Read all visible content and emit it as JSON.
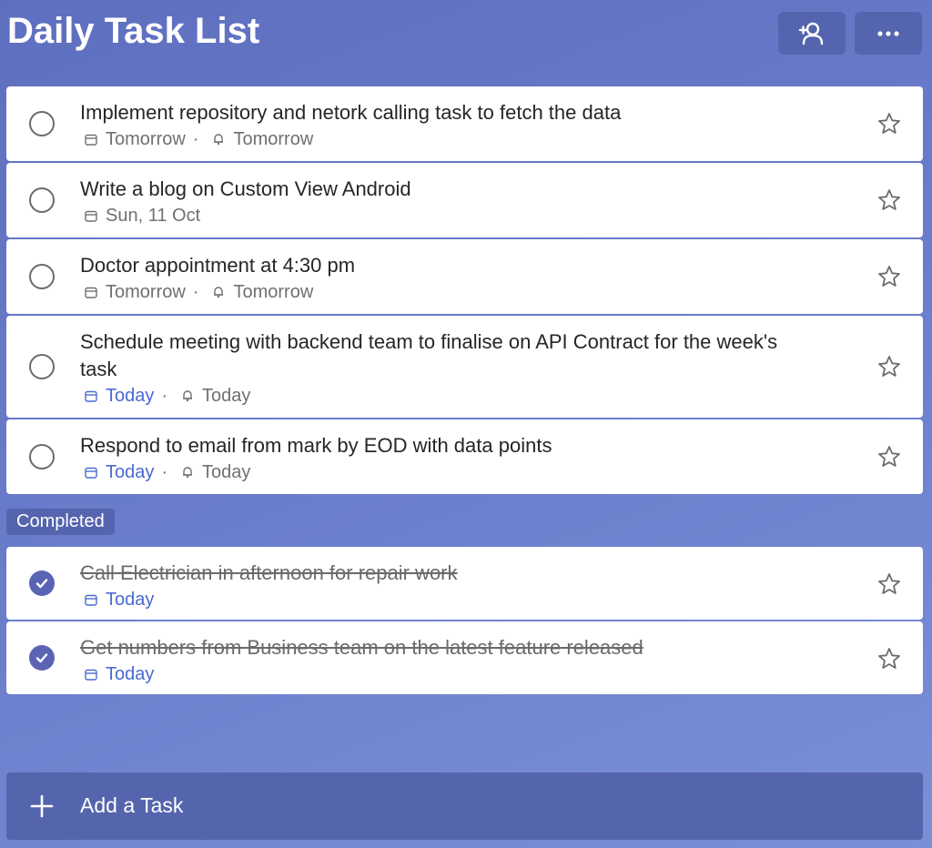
{
  "header": {
    "title": "Daily Task List",
    "share_icon": "person-add-icon",
    "more_icon": "more-horizontal-icon"
  },
  "tasks": [
    {
      "title": "Implement repository and netork calling task to fetch the data",
      "due": "Tomorrow",
      "reminder": "Tomorrow",
      "due_color": "gray"
    },
    {
      "title": "Write a blog on Custom View Android",
      "due": "Sun, 11 Oct",
      "reminder": null,
      "due_color": "gray"
    },
    {
      "title": "Doctor appointment at 4:30 pm",
      "due": "Tomorrow",
      "reminder": "Tomorrow",
      "due_color": "gray"
    },
    {
      "title": "Schedule meeting with backend team to finalise on API Contract for the week's task",
      "due": "Today",
      "reminder": "Today",
      "due_color": "blue"
    },
    {
      "title": "Respond to email from mark by EOD with data points",
      "due": "Today",
      "reminder": "Today",
      "due_color": "blue"
    }
  ],
  "completed_section": {
    "label": "Completed"
  },
  "completed_tasks": [
    {
      "title": "Call Electrician in afternoon for repair work",
      "due": "Today"
    },
    {
      "title": "Get numbers from Business team on the latest feature released",
      "due": "Today"
    }
  ],
  "add_task": {
    "label": "Add a Task"
  },
  "colors": {
    "accent_blue": "#4a6ad0",
    "check_fill": "#5b64b4",
    "background": "#6a7dcb"
  }
}
